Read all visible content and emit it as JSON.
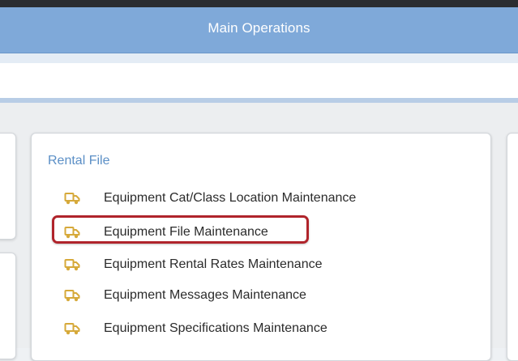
{
  "header": {
    "title": "Main Operations"
  },
  "section": {
    "heading": "Rental File",
    "items": [
      {
        "label": "Equipment Cat/Class Location Maintenance",
        "icon": "truck-icon"
      },
      {
        "label": "Equipment File Maintenance",
        "icon": "truck-icon",
        "highlighted": true
      },
      {
        "label": "Equipment Rental Rates Maintenance",
        "icon": "truck-icon"
      },
      {
        "label": "Equipment Messages Maintenance",
        "icon": "truck-icon"
      },
      {
        "label": "Equipment Specifications Maintenance",
        "icon": "truck-icon"
      }
    ]
  },
  "colors": {
    "header_bg": "#7fa9d9",
    "heading_text": "#5b8fc6",
    "icon": "#d6a93a",
    "highlight": "#b0242b"
  }
}
